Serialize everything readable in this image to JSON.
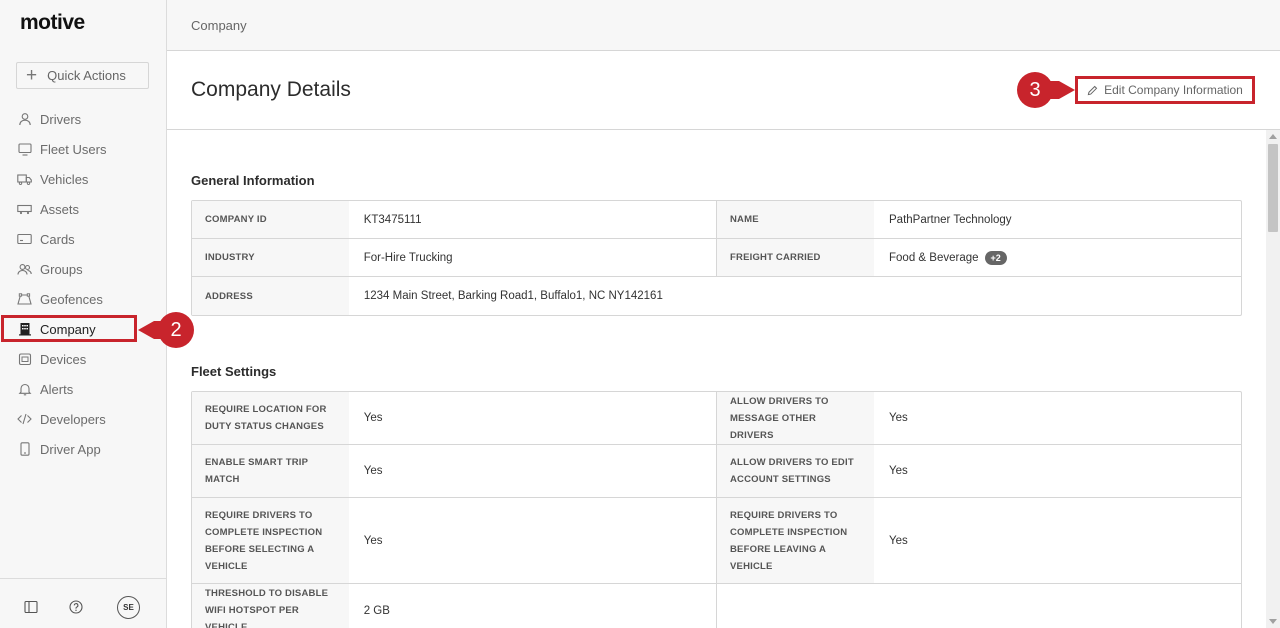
{
  "app": {
    "logo": "motive"
  },
  "sidebar": {
    "quick_actions": "Quick Actions",
    "items": [
      {
        "label": "Drivers",
        "icon": "person-icon"
      },
      {
        "label": "Fleet Users",
        "icon": "monitor-icon"
      },
      {
        "label": "Vehicles",
        "icon": "truck-icon"
      },
      {
        "label": "Assets",
        "icon": "trailer-icon"
      },
      {
        "label": "Cards",
        "icon": "card-icon"
      },
      {
        "label": "Groups",
        "icon": "groups-icon"
      },
      {
        "label": "Geofences",
        "icon": "geofence-icon"
      },
      {
        "label": "Company",
        "icon": "building-icon",
        "active": true
      },
      {
        "label": "Devices",
        "icon": "device-icon"
      },
      {
        "label": "Alerts",
        "icon": "bell-icon"
      },
      {
        "label": "Developers",
        "icon": "code-icon"
      },
      {
        "label": "Driver App",
        "icon": "phone-icon"
      }
    ],
    "footer": {
      "avatar_initials": "SE"
    }
  },
  "callouts": {
    "company_step": "2",
    "edit_step": "3"
  },
  "breadcrumb": "Company",
  "header": {
    "title": "Company Details",
    "edit_button": "Edit Company Information"
  },
  "general": {
    "title": "General Information",
    "company_id_label": "COMPANY ID",
    "company_id": "KT3475111",
    "name_label": "NAME",
    "name": "PathPartner Technology",
    "industry_label": "INDUSTRY",
    "industry": "For-Hire Trucking",
    "freight_label": "FREIGHT CARRIED",
    "freight": "Food & Beverage",
    "freight_badge": "+2",
    "address_label": "ADDRESS",
    "address": "1234 Main Street, Barking Road1, Buffalo1, NC NY142161"
  },
  "fleet": {
    "title": "Fleet Settings",
    "rows": [
      {
        "l1": "REQUIRE LOCATION FOR DUTY STATUS CHANGES",
        "v1": "Yes",
        "l2": "ALLOW DRIVERS TO MESSAGE OTHER DRIVERS",
        "v2": "Yes"
      },
      {
        "l1": "ENABLE SMART TRIP MATCH",
        "v1": "Yes",
        "l2": "ALLOW DRIVERS TO EDIT ACCOUNT SETTINGS",
        "v2": "Yes"
      },
      {
        "l1": "REQUIRE DRIVERS TO COMPLETE INSPECTION BEFORE SELECTING A VEHICLE",
        "v1": "Yes",
        "l2": "REQUIRE DRIVERS TO COMPLETE INSPECTION BEFORE LEAVING A VEHICLE",
        "v2": "Yes"
      },
      {
        "l1": "THRESHOLD TO DISABLE WIFI HOTSPOT PER VEHICLE",
        "v1": "2 GB"
      }
    ]
  },
  "colors": {
    "accent": "#c8242c"
  }
}
